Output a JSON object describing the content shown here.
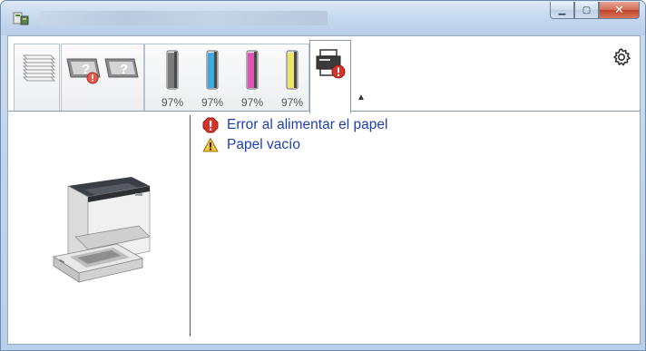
{
  "window": {
    "title": "",
    "minimize_glyph": "▁",
    "maximize_glyph": "▢",
    "close_glyph": "✕"
  },
  "toolbar": {
    "tabs": [
      {
        "name": "paper-stack",
        "icon": "paper-stack-icon"
      },
      {
        "name": "paper-status",
        "icon": "paper-question-error-icon"
      },
      {
        "name": "ink-levels",
        "icon": "toner-cartridges-icon"
      },
      {
        "name": "printer-status",
        "icon": "printer-error-icon",
        "active": true
      }
    ],
    "toner": [
      {
        "color": "#7a7a7a",
        "label": "97%",
        "level": 0.97
      },
      {
        "color": "#3ea8e0",
        "label": "97%",
        "level": 0.97
      },
      {
        "color": "#e055b4",
        "label": "97%",
        "level": 0.97
      },
      {
        "color": "#f0e36a",
        "label": "97%",
        "level": 0.97
      }
    ],
    "collapse_glyph": "▲",
    "settings_icon": "gear-icon"
  },
  "status": {
    "items": [
      {
        "type": "error",
        "icon": "error-icon",
        "text": "Error al alimentar el papel"
      },
      {
        "type": "warning",
        "icon": "warning-icon",
        "text": "Papel vacío"
      }
    ]
  },
  "colors": {
    "link_text": "#1f3fae",
    "error_red": "#d3332a",
    "warning_yellow": "#f3c237"
  }
}
